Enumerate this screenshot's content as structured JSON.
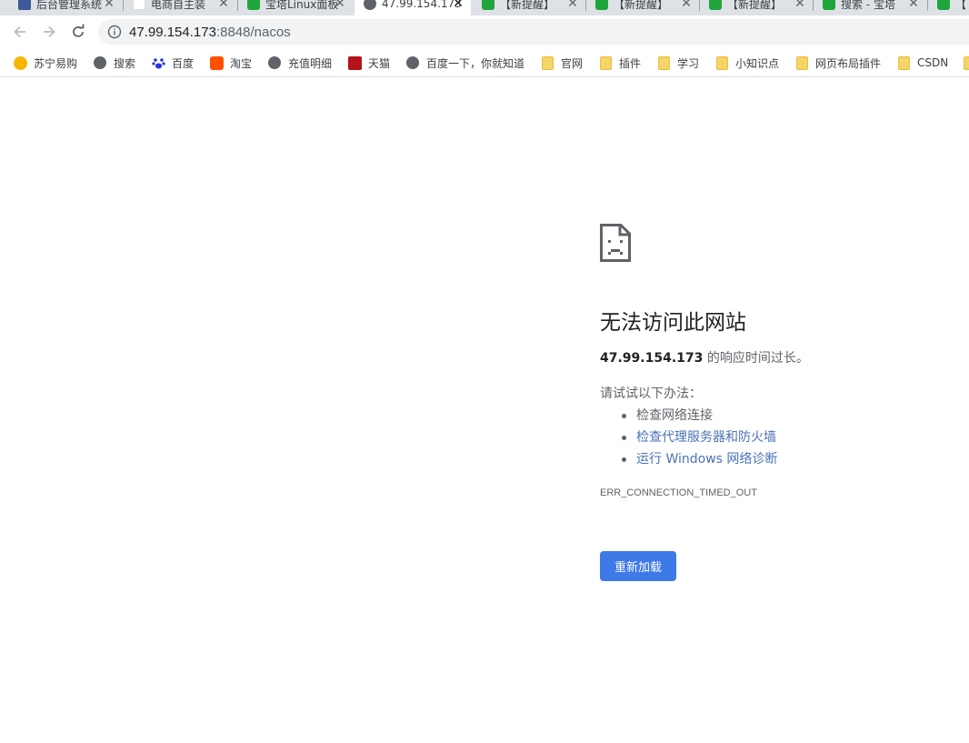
{
  "tabs": [
    {
      "title": "后台管理系统",
      "favicon": "admin-panel-icon",
      "color": "#3c5a99"
    },
    {
      "title": "电商自主装",
      "favicon": "page-icon",
      "color": "#dadce0"
    },
    {
      "title": "宝塔Linux面板",
      "favicon": "bt-panel-icon",
      "color": "#20a53a"
    },
    {
      "title": "47.99.154.173",
      "favicon": "globe-icon",
      "color": "#5f6368",
      "active": true
    },
    {
      "title": "【新提醒】",
      "favicon": "bt-panel-icon",
      "color": "#20a53a"
    },
    {
      "title": "【新提醒】",
      "favicon": "bt-panel-icon",
      "color": "#20a53a"
    },
    {
      "title": "【新提醒】",
      "favicon": "bt-panel-icon",
      "color": "#20a53a"
    },
    {
      "title": "搜索 - 宝塔",
      "favicon": "bt-panel-icon",
      "color": "#20a53a"
    },
    {
      "title": "【",
      "favicon": "bt-panel-icon",
      "color": "#20a53a"
    }
  ],
  "tab_close_glyph": "✕",
  "address": {
    "host": "47.99.154.173",
    "rest": ":8848/nacos"
  },
  "bookmarks": [
    {
      "label": "苏宁易购",
      "icon": "suning-icon"
    },
    {
      "label": "搜索",
      "icon": "globe-icon"
    },
    {
      "label": "百度",
      "icon": "baidu-paw-icon"
    },
    {
      "label": "淘宝",
      "icon": "taobao-icon"
    },
    {
      "label": "充值明细",
      "icon": "globe-icon"
    },
    {
      "label": "天猫",
      "icon": "tmall-icon"
    },
    {
      "label": "百度一下，你就知道",
      "icon": "globe-icon"
    },
    {
      "label": "官网",
      "icon": "folder-icon"
    },
    {
      "label": "插件",
      "icon": "folder-icon"
    },
    {
      "label": "学习",
      "icon": "folder-icon"
    },
    {
      "label": "小知识点",
      "icon": "folder-icon"
    },
    {
      "label": "网页布局插件",
      "icon": "folder-icon"
    },
    {
      "label": "CSDN",
      "icon": "folder-icon"
    }
  ],
  "error": {
    "icon": "sad-page-icon",
    "title": "无法访问此网站",
    "host": "47.99.154.173",
    "desc_suffix": " 的响应时间过长。",
    "try_label": "请试试以下办法：",
    "suggestions": [
      {
        "text": "检查网络连接",
        "link": false
      },
      {
        "text": "检查代理服务器和防火墙",
        "link": true
      },
      {
        "text": "运行 Windows 网络诊断",
        "link": true
      }
    ],
    "code": "ERR_CONNECTION_TIMED_OUT",
    "reload_label": "重新加载"
  },
  "colors": {
    "reload_button": "#3e79e8",
    "link": "#4a72b8",
    "tabstrip": "#dee1e6"
  }
}
